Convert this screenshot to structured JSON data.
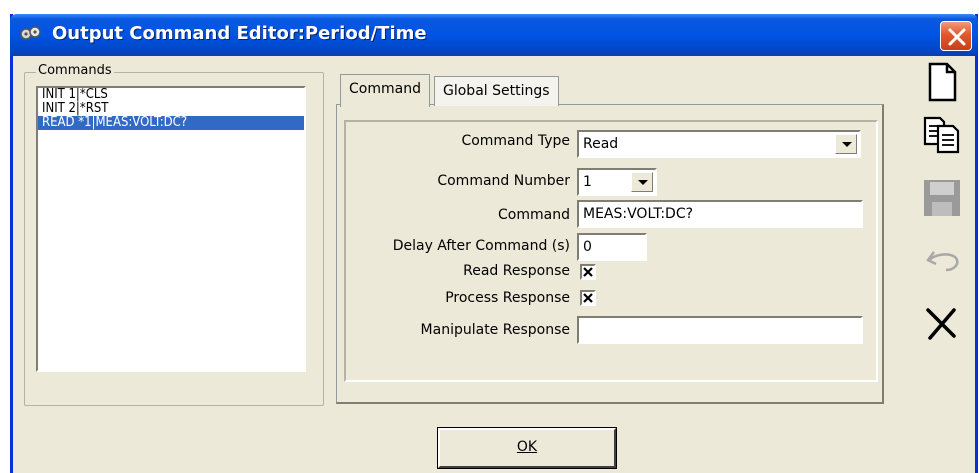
{
  "window": {
    "title": "Output Command Editor:Period/Time",
    "close_icon": "close-icon"
  },
  "commands": {
    "group_label": "Commands",
    "items": [
      {
        "label": "INIT 1|*CLS",
        "selected": false
      },
      {
        "label": "INIT 2|*RST",
        "selected": false
      },
      {
        "label": "READ *1|MEAS:VOLT:DC?",
        "selected": true
      }
    ]
  },
  "tabs": [
    {
      "label": "Command",
      "active": true
    },
    {
      "label": "Global Settings",
      "active": false
    }
  ],
  "form": {
    "command_type_label": "Command Type",
    "command_type_value": "Read",
    "command_number_label": "Command Number",
    "command_number_value": "1",
    "command_label": "Command",
    "command_value": "MEAS:VOLT:DC?",
    "delay_label": "Delay After Command (s)",
    "delay_value": "0",
    "read_response_label": "Read Response",
    "read_response_checked": true,
    "process_response_label": "Process Response",
    "process_response_checked": true,
    "manipulate_response_label": "Manipulate Response",
    "manipulate_response_value": ""
  },
  "buttons": {
    "ok_label": "OK"
  },
  "toolbar": [
    {
      "icon": "new-document-icon",
      "enabled": true
    },
    {
      "icon": "copy-icon",
      "enabled": true
    },
    {
      "icon": "save-icon",
      "enabled": false
    },
    {
      "icon": "undo-icon",
      "enabled": false
    },
    {
      "icon": "delete-icon",
      "enabled": true
    }
  ],
  "colors": {
    "titlebar": "#0054e3",
    "selection": "#316ac5",
    "close": "#e2572d",
    "dialog": "#ece9d8"
  }
}
